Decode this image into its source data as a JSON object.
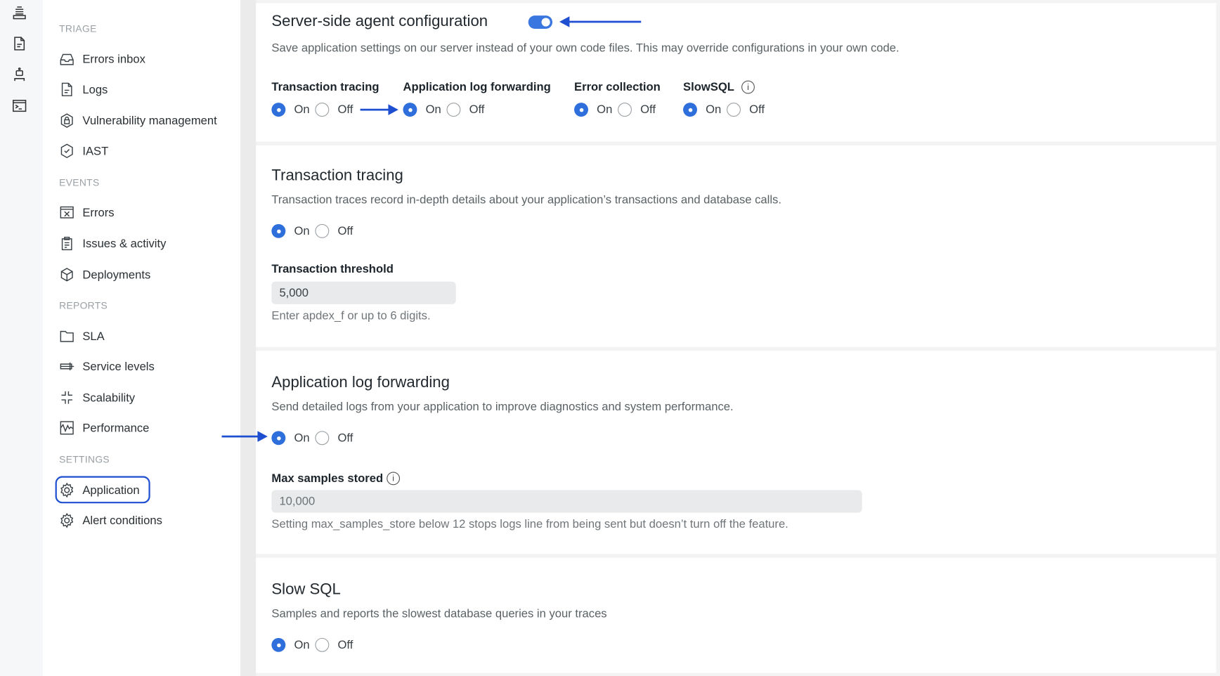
{
  "sidebar": {
    "sections": [
      "TRIAGE",
      "EVENTS",
      "REPORTS",
      "SETTINGS"
    ],
    "items": [
      {
        "label": "Errors inbox",
        "icon": "inbox-icon"
      },
      {
        "label": "Logs",
        "icon": "document-icon"
      },
      {
        "label": "Vulnerability management",
        "icon": "lock-shield-icon"
      },
      {
        "label": "IAST",
        "icon": "check-shield-icon"
      },
      {
        "label": "Errors",
        "icon": "error-window-icon"
      },
      {
        "label": "Issues & activity",
        "icon": "clipboard-icon"
      },
      {
        "label": "Deployments",
        "icon": "cube-icon"
      },
      {
        "label": "SLA",
        "icon": "folder-icon"
      },
      {
        "label": "Service levels",
        "icon": "service-levels-icon"
      },
      {
        "label": "Scalability",
        "icon": "scale-icon"
      },
      {
        "label": "Performance",
        "icon": "performance-chart-icon"
      },
      {
        "label": "Application",
        "icon": "gear-icon",
        "selected": true
      },
      {
        "label": "Alert conditions",
        "icon": "gear-icon"
      }
    ]
  },
  "rail": {
    "icons": [
      "list-icon",
      "document-icon",
      "robot-icon",
      "terminal-icon"
    ]
  },
  "server_side": {
    "title": "Server-side agent configuration",
    "enabled": true,
    "description": "Save application settings on our server instead of your own code files. This may override configurations in your own code.",
    "groups": [
      {
        "label": "Transaction tracing",
        "value": "On"
      },
      {
        "label": "Application log forwarding",
        "value": "On"
      },
      {
        "label": "Error collection",
        "value": "On"
      },
      {
        "label": "SlowSQL",
        "value": "On",
        "info": true
      }
    ]
  },
  "radio": {
    "on": "On",
    "off": "Off"
  },
  "transaction_tracing": {
    "title": "Transaction tracing",
    "description": "Transaction traces record in-depth details about your application’s transactions and database calls.",
    "value": "On",
    "threshold_label": "Transaction threshold",
    "threshold_value": "5,000",
    "threshold_hint": "Enter apdex_f or up to 6 digits."
  },
  "log_forwarding": {
    "title": "Application log forwarding",
    "description": "Send detailed logs from your application to improve diagnostics and system performance.",
    "value": "On",
    "max_label": "Max samples stored",
    "max_value": "10,000",
    "max_hint": "Setting max_samples_store below 12 stops logs line from being sent but doesn’t turn off the feature."
  },
  "slow_sql": {
    "title": "Slow SQL",
    "description": "Samples and reports the slowest database queries in your traces",
    "value": "On"
  },
  "colors": {
    "accent": "#2f6fdc",
    "annotation_arrow": "#1f4fd1"
  }
}
